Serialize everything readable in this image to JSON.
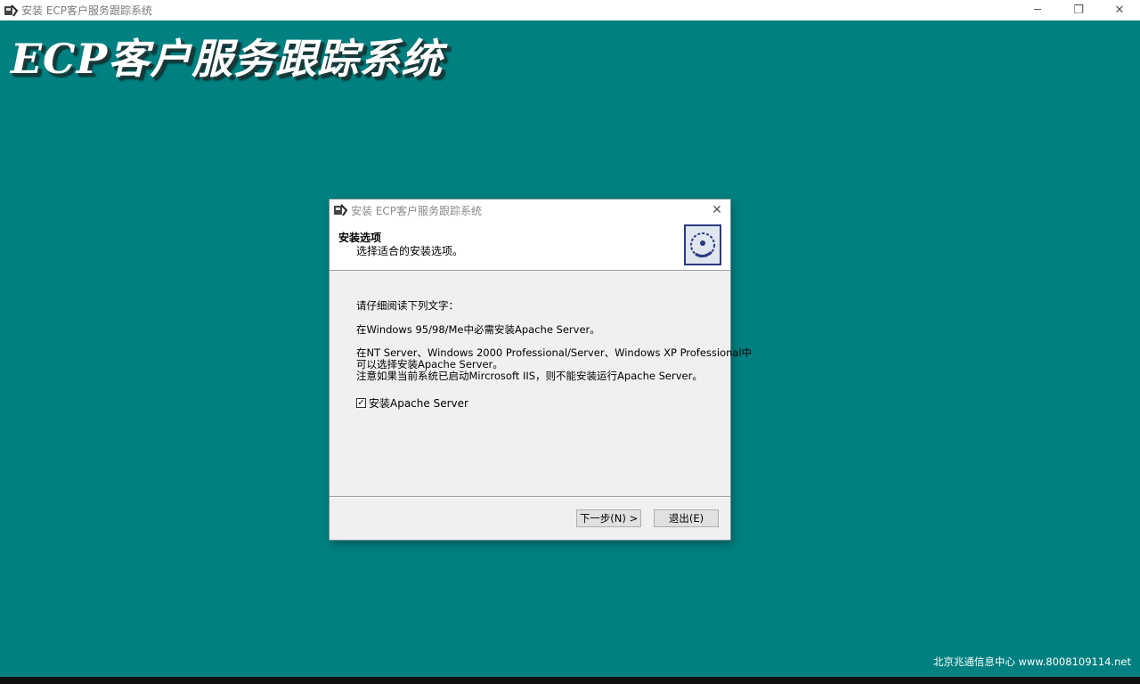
{
  "window": {
    "title": "安装 ECP客户服务跟踪系统",
    "icon": "installer-icon",
    "minimize": "─",
    "restore": "❐",
    "close": "✕"
  },
  "banner": {
    "title": "ECP客户服务跟踪系统"
  },
  "dialog": {
    "title": "安装 ECP客户服务跟踪系统",
    "close": "✕",
    "header": {
      "title": "安装选项",
      "subtitle": "选择适合的安装选项。",
      "logo": "installer-disk-icon"
    },
    "body": {
      "line1": "请仔细阅读下列文字：",
      "line2": "在Windows 95/98/Me中必需安装Apache Server。",
      "line3a": "在NT Server、Windows 2000 Professional/Server、Windows XP Professional中",
      "line3b": "可以选择安装Apache Server。",
      "line3c": "注意如果当前系统已启动Mircrosoft IIS，则不能安装运行Apache Server。",
      "checkbox_label": "安装Apache Server",
      "checkbox_checked": true,
      "checkbox_mark": "✓"
    },
    "buttons": {
      "next": "下一步(N) >",
      "exit": "退出(E)"
    }
  },
  "footer": {
    "text": "北京兆通信息中心 www.8008109114.net"
  },
  "colors": {
    "desktop": "#008080",
    "dialog_bg": "#f0f0f0"
  }
}
